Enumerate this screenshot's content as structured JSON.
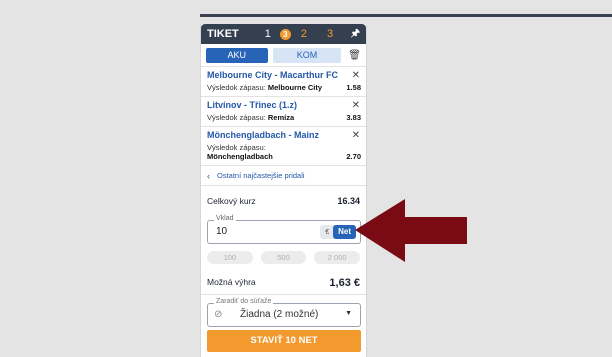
{
  "header": {
    "title": "TIKET",
    "tabs": [
      "1",
      "2",
      "3"
    ],
    "badge": "3",
    "pin_icon": "pin-icon"
  },
  "mode_tabs": {
    "aku": "AKU",
    "kom": "KOM"
  },
  "bets": [
    {
      "match": "Melbourne City - Macarthur FC",
      "label": "Výsledok zápasu:",
      "pick": "Melbourne City",
      "odds": "1.58"
    },
    {
      "match": "Litvínov - Třinec (1.z)",
      "label": "Výsledok zápasu:",
      "pick": "Remíza",
      "odds": "3.83"
    },
    {
      "match": "Mönchengladbach - Mainz",
      "label": "Výsledok zápasu:",
      "pick": "Mönchengladbach",
      "odds": "2.70"
    }
  ],
  "more_link": "Ostatní najčastejšie pridali",
  "total": {
    "label": "Celkový kurz",
    "value": "16.34"
  },
  "stake": {
    "label": "Vklad",
    "value": "10",
    "currency": "€",
    "type": "Net"
  },
  "quick_amounts": [
    "100",
    "500",
    "2 000"
  ],
  "win": {
    "label": "Možná výhra",
    "value": "1,63 €"
  },
  "competition": {
    "label": "Zaradiť do súťaže",
    "value": "Žiadna (2 možné)"
  },
  "cta": "STAVIŤ 10 NET",
  "colors": {
    "header": "#34404f",
    "primary": "#2763b6",
    "accent": "#f29a2e",
    "arrow": "#7a0a14"
  }
}
